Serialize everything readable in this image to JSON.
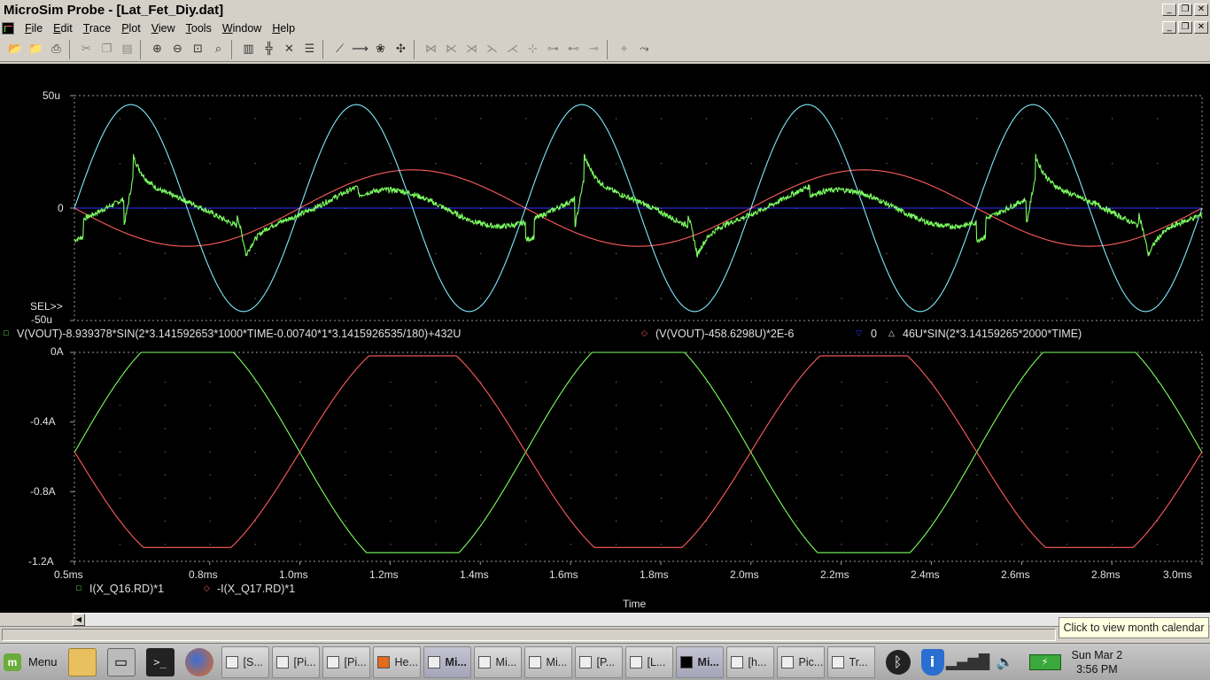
{
  "window": {
    "title": "MicroSim Probe - [Lat_Fet_Diy.dat]"
  },
  "menu": [
    "File",
    "Edit",
    "Trace",
    "Plot",
    "View",
    "Tools",
    "Window",
    "Help"
  ],
  "window_buttons": {
    "minimize": "_",
    "restore": "❐",
    "close": "✕"
  },
  "colors": {
    "background": "#000000",
    "cyan": "#7fe9ff",
    "green": "#7dff62",
    "red": "#ff5c5c",
    "blue": "#3030ff",
    "grid": "#9a9a9a"
  },
  "chart_data": [
    {
      "type": "line",
      "title": "",
      "yticks": [
        "50u",
        "0",
        "-50u"
      ],
      "ylim": [
        -50,
        50
      ],
      "xlim": [
        0.5,
        3.0
      ],
      "selection_marker": "SEL>>",
      "legend": [
        {
          "marker": "□",
          "name": "V(VOUT)-8.939378*SIN(2*3.141592653*1000*TIME-0.00740*1*3.1415926535/180)+432U",
          "color": "#7dff62"
        },
        {
          "marker": "◇",
          "name": "(V(VOUT)-458.6298U)*2E-6",
          "color": "#ff5c5c"
        },
        {
          "marker": "▽",
          "name": "0",
          "color": "#3030ff"
        },
        {
          "marker": "△",
          "name": "46U*SIN(2*3.14159265*2000*TIME)",
          "color": "#7fe9ff"
        }
      ],
      "series": [
        {
          "name": "V(VOUT)-8.939378*SIN(2*3.141592653*1000*TIME-0.00740*1*3.1415926535/180)+432U",
          "color": "#7dff62",
          "style": "distortion residual, approx. peaks +28u / -28u near 0.63, 0.88, 1.63, 1.88, 2.63, 2.88 ms"
        },
        {
          "name": "(V(VOUT)-458.6298U)*2E-6",
          "color": "#ff5c5c",
          "amplitude": 17,
          "frequency_khz": 1,
          "phase": "negative sine"
        },
        {
          "name": "0",
          "color": "#3030ff",
          "values": [
            0
          ]
        },
        {
          "name": "46U*SIN(2*3.14159265*2000*TIME)",
          "color": "#7fe9ff",
          "amplitude": 46,
          "frequency_khz": 2
        }
      ]
    },
    {
      "type": "line",
      "yticks": [
        "0A",
        "-0.4A",
        "-0.8A",
        "-1.2A"
      ],
      "ylim": [
        -1.2,
        0
      ],
      "xticks": [
        "0.5ms",
        "0.8ms",
        "1.0ms",
        "1.2ms",
        "1.4ms",
        "1.6ms",
        "1.8ms",
        "2.0ms",
        "2.2ms",
        "2.4ms",
        "2.6ms",
        "2.8ms",
        "3.0ms"
      ],
      "xtick_values": [
        0.5,
        0.8,
        1.0,
        1.2,
        1.4,
        1.6,
        1.8,
        2.0,
        2.2,
        2.4,
        2.6,
        2.8,
        3.0
      ],
      "xlim": [
        0.5,
        3.0
      ],
      "xlabel": "Time",
      "legend": [
        {
          "marker": "□",
          "name": "I(X_Q16.RD)*1",
          "color": "#7dff62"
        },
        {
          "marker": "◇",
          "name": "-I(X_Q17.RD)*1",
          "color": "#ff5c5c"
        }
      ],
      "series": [
        {
          "name": "I(X_Q16.RD)*1",
          "color": "#7dff62",
          "min": -1.15,
          "max": 0,
          "frequency_khz": 1
        },
        {
          "name": "-I(X_Q17.RD)*1",
          "color": "#ff5c5c",
          "min": -1.12,
          "max": -0.02,
          "frequency_khz": 1
        }
      ]
    }
  ],
  "tooltip": "Click to view month calendar",
  "taskbar": {
    "menu_label": "Menu",
    "tasks": [
      "[S...",
      "[Pi...",
      "[Pi...",
      "He...",
      "Mi...",
      "Mi...",
      "Mi...",
      "[P...",
      "[L...",
      "Mi...",
      "[h...",
      "Pic...",
      "Tr..."
    ],
    "clock_date": "Sun Mar  2",
    "clock_time": "3:56 PM"
  }
}
